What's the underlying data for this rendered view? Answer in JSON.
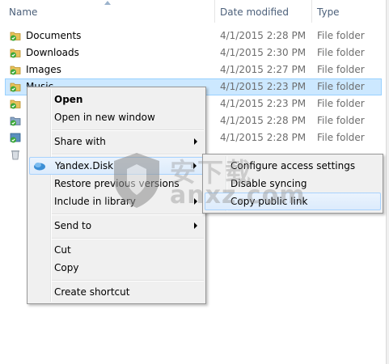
{
  "columns": {
    "name": "Name",
    "date_modified": "Date modified",
    "type": "Type"
  },
  "files": [
    {
      "name": "Documents",
      "date": "4/1/2015 2:28 PM",
      "type": "File folder",
      "icon": "folder-synced-icon"
    },
    {
      "name": "Downloads",
      "date": "4/1/2015 2:30 PM",
      "type": "File folder",
      "icon": "folder-synced-icon"
    },
    {
      "name": "Images",
      "date": "4/1/2015 2:27 PM",
      "type": "File folder",
      "icon": "folder-synced-icon"
    },
    {
      "name": "Music",
      "date": "4/1/2015 2:23 PM",
      "type": "File folder",
      "icon": "folder-synced-icon"
    },
    {
      "name": "",
      "date": "4/1/2015 2:23 PM",
      "type": "File folder",
      "icon": "folder-synced-icon"
    },
    {
      "name": "",
      "date": "4/1/2015 2:28 PM",
      "type": "File folder",
      "icon": "folder-synced-icon"
    },
    {
      "name": "",
      "date": "4/1/2015 2:28 PM",
      "type": "File folder",
      "icon": "folder-synced-icon"
    },
    {
      "name": "",
      "date": "",
      "type": "",
      "icon": "recycle-bin-icon"
    }
  ],
  "context_menu": {
    "open": "Open",
    "open_new_window": "Open in new window",
    "share_with": "Share with",
    "yandex_disk": "Yandex.Disk",
    "restore_previous": "Restore previous versions",
    "include_library": "Include in library",
    "send_to": "Send to",
    "cut": "Cut",
    "copy": "Copy",
    "create_shortcut": "Create shortcut"
  },
  "submenu": {
    "configure_access": "Configure access settings",
    "disable_syncing": "Disable syncing",
    "copy_public_link": "Copy public link"
  },
  "watermark": {
    "text": "anxz.com",
    "cn_text": "安下载"
  },
  "colors": {
    "selection": "#cce8ff",
    "menu_bg": "#f0f0f0",
    "sync_check": "#3ba838",
    "folder": "#e8c15a"
  }
}
